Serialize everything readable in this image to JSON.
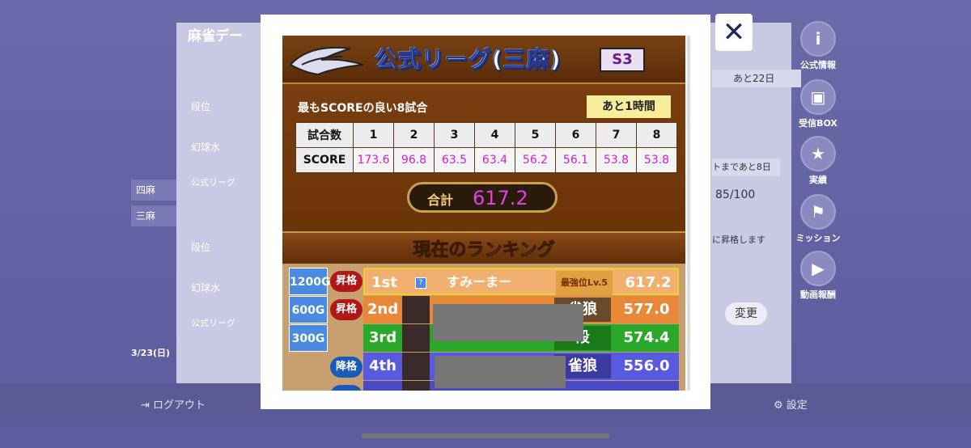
{
  "background": {
    "panel_title": "麻雀デー",
    "left_labels": [
      "段位",
      "幻球水",
      "公式リーグ",
      "段位",
      "幻球水",
      "公式リーグ"
    ],
    "tabs": [
      "四麻",
      "三麻"
    ],
    "right_texts": [
      "あと22日",
      "トまであと8日",
      "85/100",
      "に昇格します"
    ],
    "change_button": "変更",
    "side_icons": [
      {
        "label": "公式情報",
        "icon": "info-icon"
      },
      {
        "label": "受信BOX",
        "icon": "gift-icon"
      },
      {
        "label": "実績",
        "icon": "medal-icon"
      },
      {
        "label": "ミッション",
        "icon": "flag-icon"
      },
      {
        "label": "動画報酬",
        "icon": "video-icon"
      }
    ],
    "bottom_left": "ログアウト",
    "bottom_right": "設定",
    "date_fragment": "3/23(日)"
  },
  "modal": {
    "close_label": "✕",
    "title": "公式リーグ(三麻)",
    "season": "S3",
    "best_games_label": "最もSCOREの良い8試合",
    "remaining": "あと1時間",
    "score_table": {
      "header_label": "試合数",
      "row_label": "SCORE",
      "games": [
        "1",
        "2",
        "3",
        "4",
        "5",
        "6",
        "7",
        "8"
      ],
      "scores": [
        "173.6",
        "96.8",
        "63.5",
        "63.4",
        "56.2",
        "56.1",
        "53.8",
        "53.8"
      ]
    },
    "total_label": "合計",
    "total_value": "617.2",
    "ranking_title": "現在のランキング",
    "gold_rewards": [
      "1200G",
      "600G",
      "300G"
    ],
    "tags": {
      "promote": "昇格",
      "demote": "降格"
    },
    "rows": [
      {
        "position": "1st",
        "name": "すみーまー",
        "rank": "最強位Lv.5",
        "score": "617.2"
      },
      {
        "position": "2nd",
        "name": "",
        "rank": "雀狼",
        "score": "577.0"
      },
      {
        "position": "3rd",
        "name": "",
        "rank": "段",
        "score": "574.4"
      },
      {
        "position": "4th",
        "name": "",
        "rank": "雀狼",
        "score": "556.0"
      },
      {
        "position": "5th",
        "name": "",
        "rank": "",
        "score": ""
      }
    ]
  },
  "colors": {
    "score_magenta": "#d020d0",
    "accent_gold": "#f6ec9a"
  }
}
